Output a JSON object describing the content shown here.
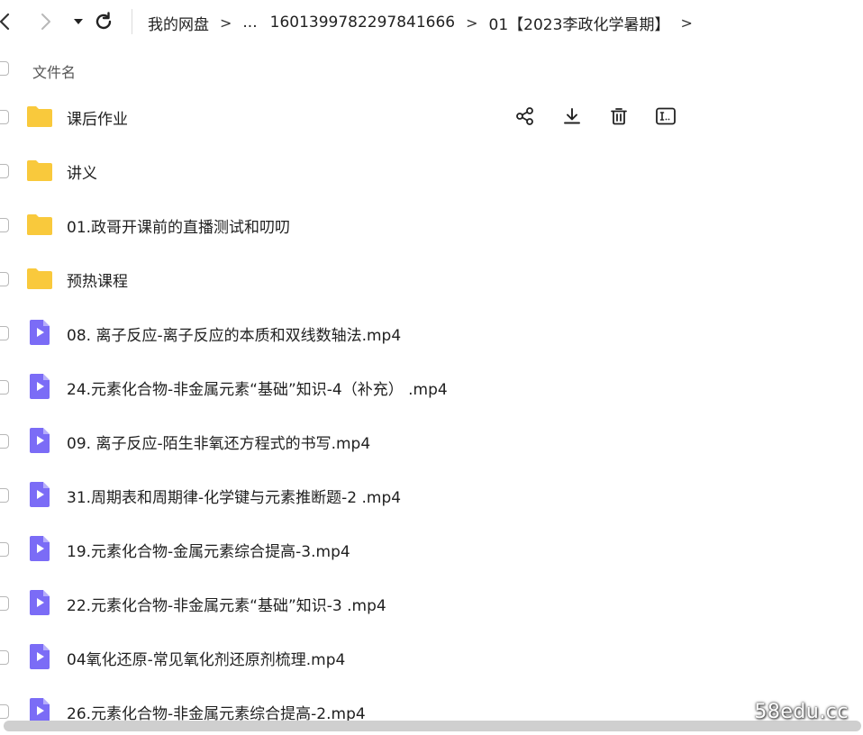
{
  "nav": {
    "back_icon": "chevron-left-icon",
    "forward_icon": "chevron-right-icon",
    "history_icon": "caret-down-icon",
    "refresh_icon": "refresh-icon"
  },
  "breadcrumb": {
    "items": [
      "我的网盘",
      "...",
      "1601399782297841666",
      "01【2023李政化学暑期】"
    ],
    "separator": ">"
  },
  "header": {
    "column_name": "文件名"
  },
  "files": [
    {
      "name": "课后作业",
      "type": "folder"
    },
    {
      "name": "讲义",
      "type": "folder"
    },
    {
      "name": "01.政哥开课前的直播测试和叨叨",
      "type": "folder"
    },
    {
      "name": "预热课程",
      "type": "folder"
    },
    {
      "name": "08. 离子反应-离子反应的本质和双线数轴法.mp4",
      "type": "video"
    },
    {
      "name": "24.元素化合物-非金属元素“基础”知识-4（补充） .mp4",
      "type": "video"
    },
    {
      "name": "09. 离子反应-陌生非氧还方程式的书写.mp4",
      "type": "video"
    },
    {
      "name": "31.周期表和周期律-化学键与元素推断题-2 .mp4",
      "type": "video"
    },
    {
      "name": "19.元素化合物-金属元素综合提高-3.mp4",
      "type": "video"
    },
    {
      "name": "22.元素化合物-非金属元素“基础”知识-3 .mp4",
      "type": "video"
    },
    {
      "name": "04氧化还原-常见氧化剂还原剂梳理.mp4",
      "type": "video"
    },
    {
      "name": "26.元素化合物-非金属元素综合提高-2.mp4",
      "type": "video"
    }
  ],
  "row_actions": [
    "share-icon",
    "download-icon",
    "delete-icon",
    "rename-icon"
  ],
  "colors": {
    "folder": "#F9C93C",
    "video": "#7B6CF6",
    "text": "#1f1f1f"
  },
  "watermark": "58edu.cc"
}
